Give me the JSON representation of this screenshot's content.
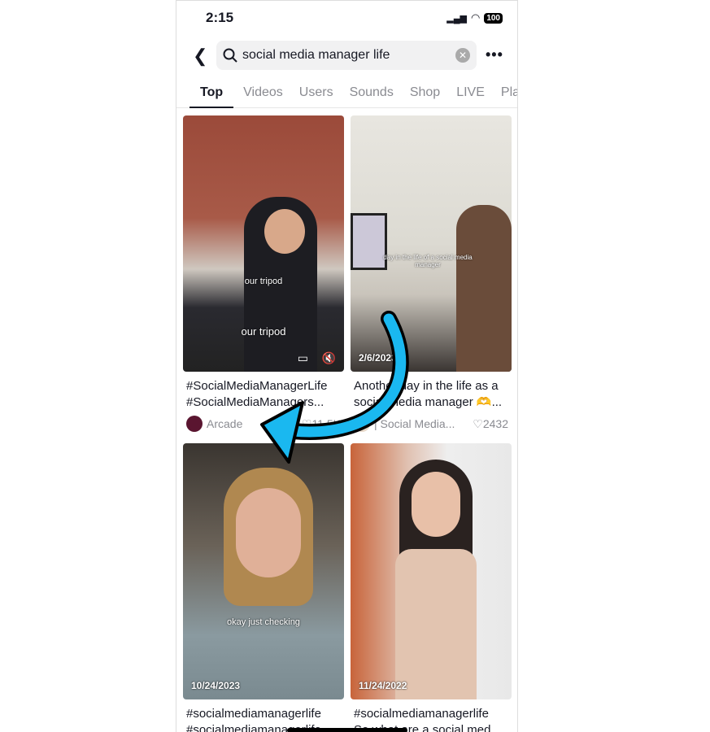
{
  "status": {
    "time": "2:15",
    "battery": "100"
  },
  "search": {
    "query": "social media manager life"
  },
  "tabs": [
    "Top",
    "Videos",
    "Users",
    "Sounds",
    "Shop",
    "LIVE",
    "Pla"
  ],
  "videos": [
    {
      "caption1": "#SocialMediaManagerLife",
      "caption2": "#SocialMediaManagers...",
      "author": "Arcade",
      "likes": "11.5K",
      "overlay1": "our tripod",
      "overlay2": "our tripod",
      "date": ""
    },
    {
      "caption1": "Another day in the life as a",
      "caption2": "social media manager 🫶...",
      "author": "| Social Media...",
      "likes": "2432",
      "overlay1": "day in the life of a social media manager",
      "date": "2/6/2023"
    },
    {
      "caption1": "#socialmediamanagerlife",
      "caption2": "#socialmediamanagerlife",
      "overlay1": "okay just checking",
      "date": "10/24/2023"
    },
    {
      "caption1": "#socialmediamanagerlife",
      "caption2": "So what are a social med...",
      "date": "11/24/2022"
    }
  ],
  "colors": {
    "arrow": "#1ab8f0",
    "active_tab": "#161823",
    "inactive_tab": "#8a8b91"
  }
}
